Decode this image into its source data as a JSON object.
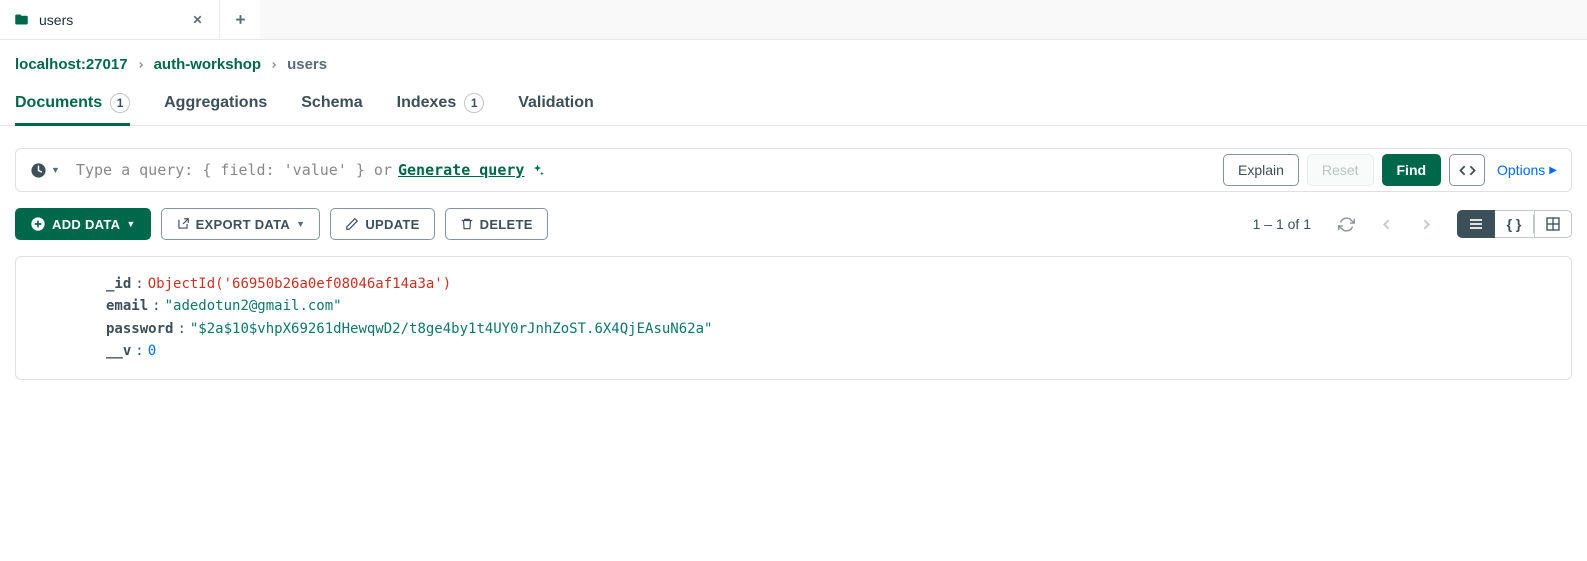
{
  "tab": {
    "label": "users"
  },
  "breadcrumb": {
    "host": "localhost:27017",
    "db": "auth-workshop",
    "collection": "users"
  },
  "navtabs": {
    "documents": {
      "label": "Documents",
      "count": "1"
    },
    "aggregations": {
      "label": "Aggregations"
    },
    "schema": {
      "label": "Schema"
    },
    "indexes": {
      "label": "Indexes",
      "count": "1"
    },
    "validation": {
      "label": "Validation"
    }
  },
  "query": {
    "placeholder_prefix": "Type a query: { field: 'value' } or ",
    "generate_label": "Generate query",
    "explain": "Explain",
    "reset": "Reset",
    "find": "Find",
    "options": "Options"
  },
  "actions": {
    "add_data": "ADD DATA",
    "export_data": "EXPORT DATA",
    "update": "UPDATE",
    "delete": "DELETE",
    "pager": "1 – 1 of 1"
  },
  "doc": {
    "k_id": "_id",
    "v_id": "ObjectId('66950b26a0ef08046af14a3a')",
    "k_email": "email",
    "v_email": "\"adedotun2@gmail.com\"",
    "k_password": "password",
    "v_password": "\"$2a$10$vhpX69261dHewqwD2/t8ge4by1t4UY0rJnhZoST.6X4QjEAsuN62a\"",
    "k_v": "__v",
    "v_v": "0"
  }
}
